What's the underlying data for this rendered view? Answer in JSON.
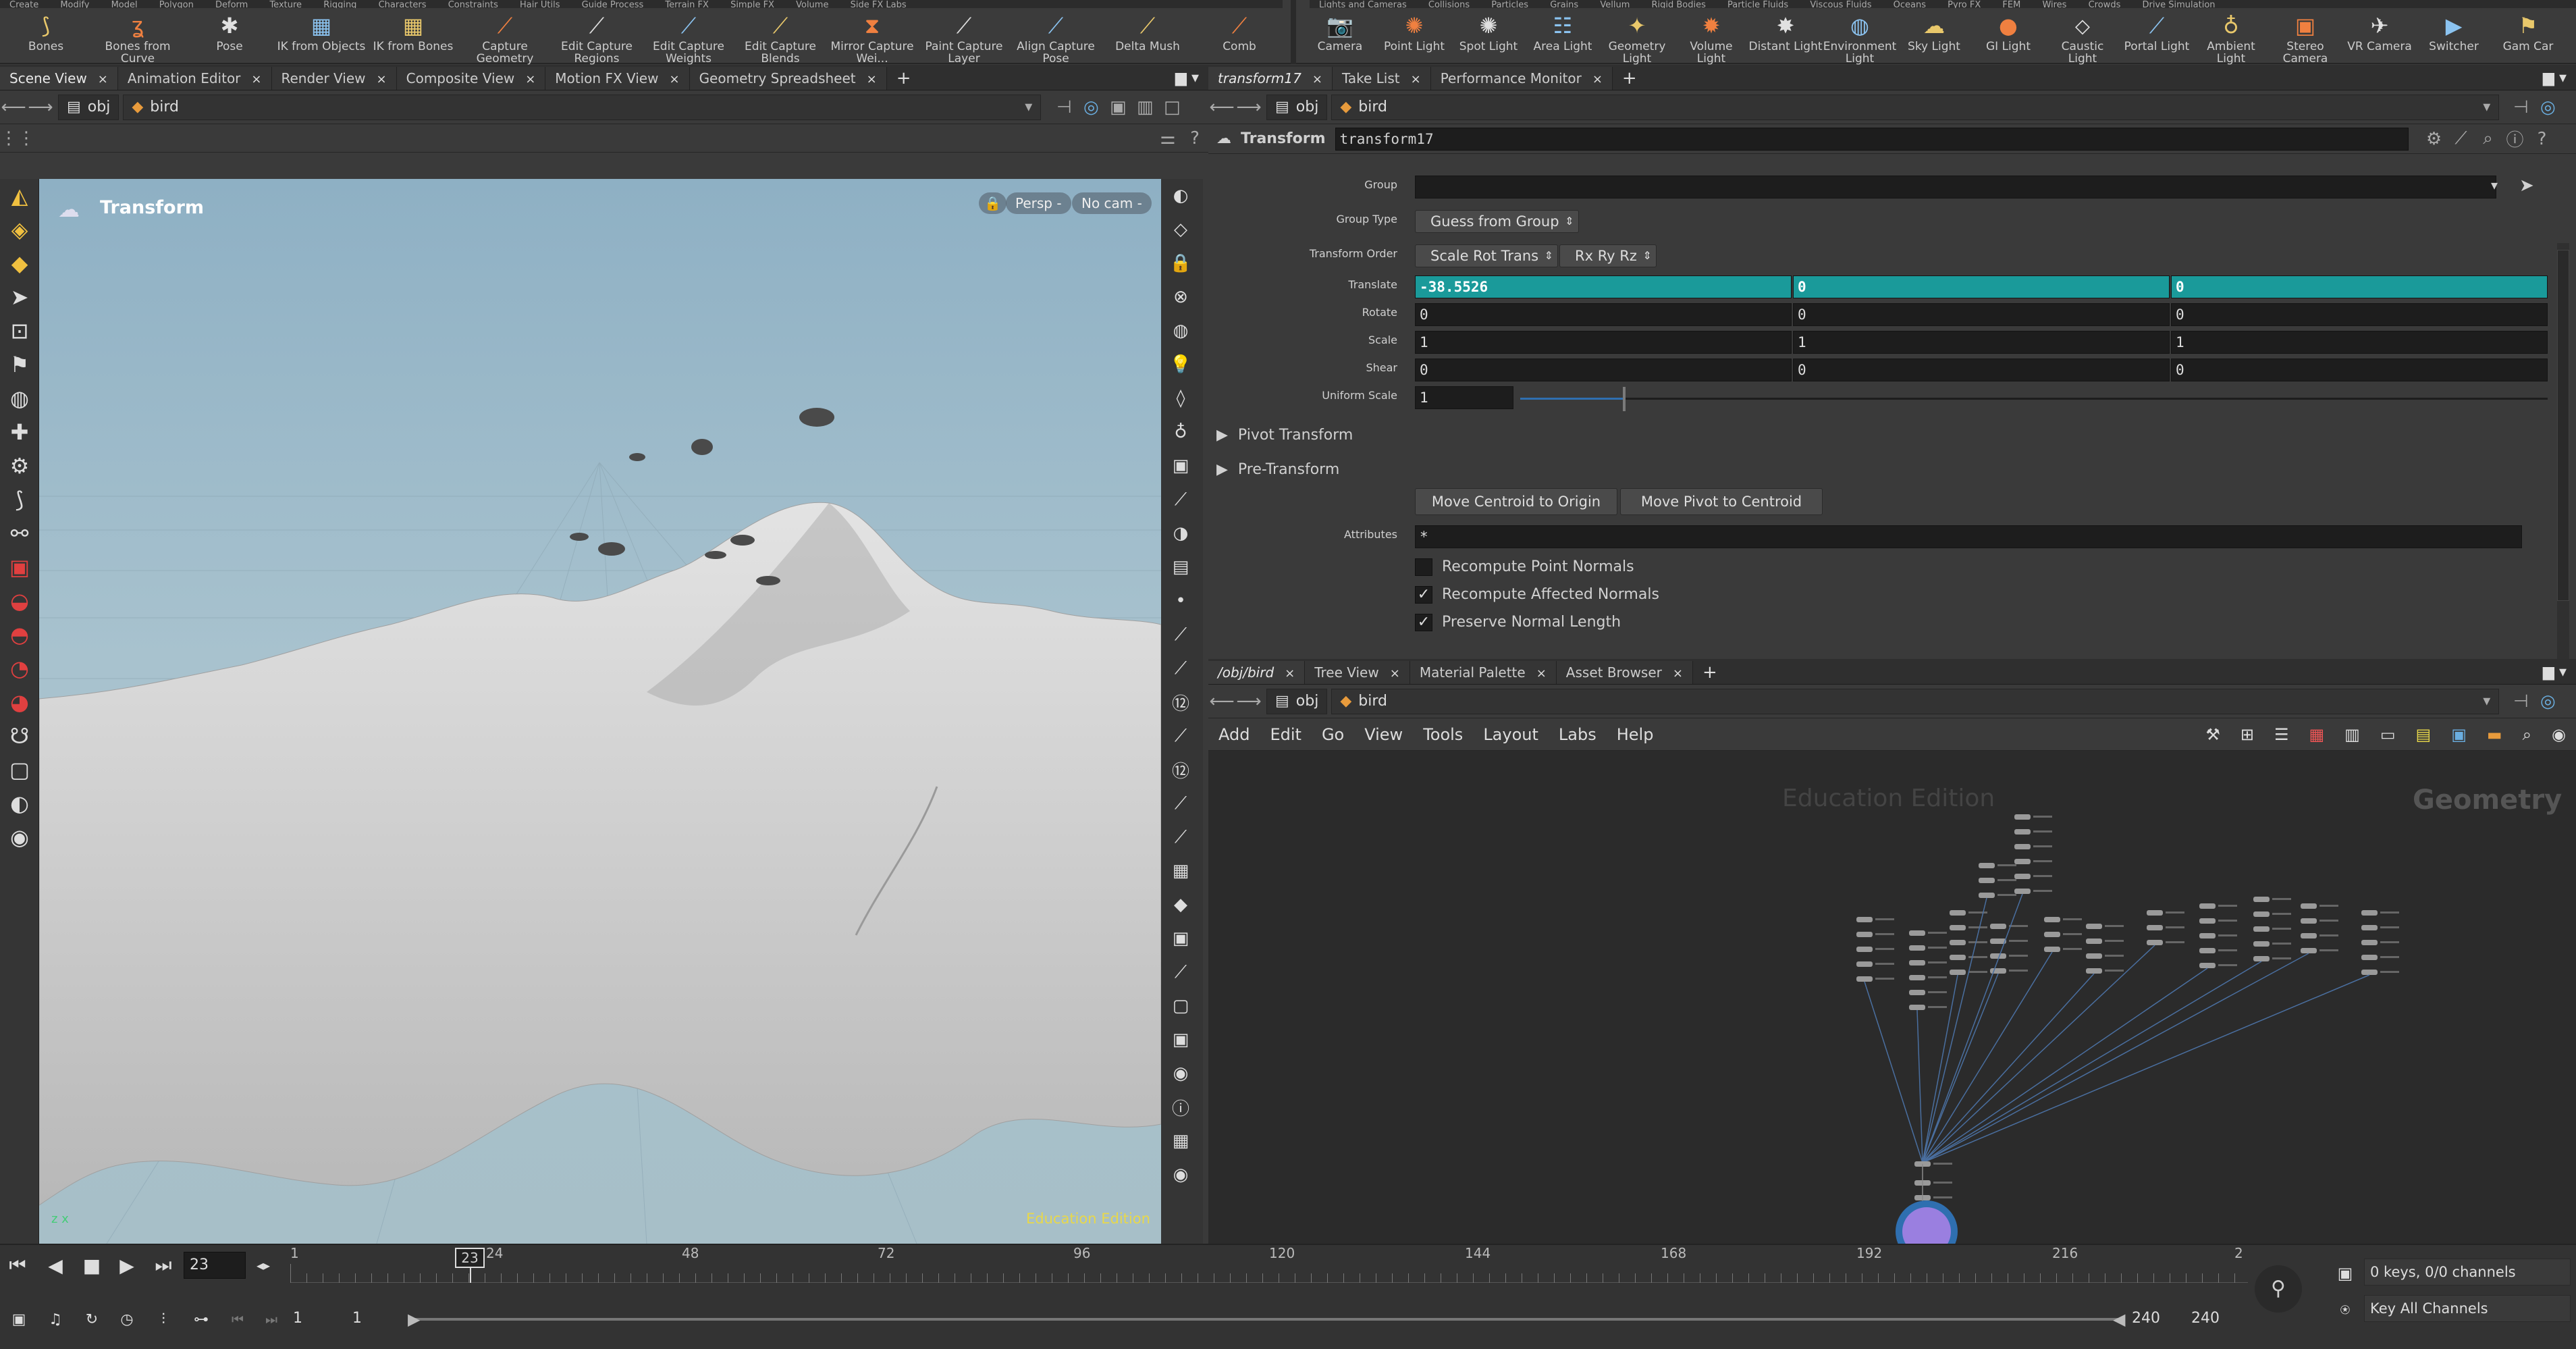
{
  "shelf": {
    "tabs_left": [
      "Create",
      "Modify",
      "Model",
      "Polygon",
      "Deform",
      "Texture",
      "Rigging",
      "Characters",
      "Constraints",
      "Hair Utils",
      "Guide Process",
      "Terrain FX",
      "Simple FX",
      "Volume",
      "Side FX Labs"
    ],
    "tabs_right": [
      "Lights and Cameras",
      "Collisions",
      "Particles",
      "Grains",
      "Vellum",
      "Rigid Bodies",
      "Particle Fluids",
      "Viscous Fluids",
      "Oceans",
      "Pyro FX",
      "FEM",
      "Wires",
      "Crowds",
      "Drive Simulation"
    ],
    "tools_left": [
      {
        "label": "Bones",
        "icon": "bones-icon",
        "glyph": "⟆"
      },
      {
        "label": "Bones from Curve",
        "icon": "bones-curve-icon",
        "glyph": "ʓ"
      },
      {
        "label": "Pose",
        "icon": "pose-icon",
        "glyph": "✱"
      },
      {
        "label": "IK from Objects",
        "icon": "ik-objects-icon",
        "glyph": "▦"
      },
      {
        "label": "IK from Bones",
        "icon": "ik-bones-icon",
        "glyph": "▦"
      },
      {
        "label": "Capture Geometry",
        "icon": "capture-geometry-icon",
        "glyph": "⟋"
      },
      {
        "label": "Edit Capture Regions",
        "icon": "edit-capture-regions-icon",
        "glyph": "⟋"
      },
      {
        "label": "Edit Capture Weights",
        "icon": "edit-capture-weights-icon",
        "glyph": "⟋"
      },
      {
        "label": "Edit Capture Blends",
        "icon": "edit-capture-blends-icon",
        "glyph": "⟋"
      },
      {
        "label": "Mirror Capture Wei...",
        "icon": "mirror-capture-icon",
        "glyph": "⧗"
      },
      {
        "label": "Paint Capture Layer",
        "icon": "paint-capture-icon",
        "glyph": "⟋"
      },
      {
        "label": "Align Capture Pose",
        "icon": "align-capture-icon",
        "glyph": "⟋"
      },
      {
        "label": "Delta Mush",
        "icon": "delta-mush-icon",
        "glyph": "⟋"
      },
      {
        "label": "Comb",
        "icon": "comb-icon",
        "glyph": "⟋"
      }
    ],
    "tools_right": [
      {
        "label": "Camera",
        "icon": "camera-icon",
        "glyph": "📷"
      },
      {
        "label": "Point Light",
        "icon": "point-light-icon",
        "glyph": "✺"
      },
      {
        "label": "Spot Light",
        "icon": "spot-light-icon",
        "glyph": "✺"
      },
      {
        "label": "Area Light",
        "icon": "area-light-icon",
        "glyph": "☷"
      },
      {
        "label": "Geometry Light",
        "icon": "geometry-light-icon",
        "glyph": "✦"
      },
      {
        "label": "Volume Light",
        "icon": "volume-light-icon",
        "glyph": "✹"
      },
      {
        "label": "Distant Light",
        "icon": "distant-light-icon",
        "glyph": "✸"
      },
      {
        "label": "Environment Light",
        "icon": "environment-light-icon",
        "glyph": "◍"
      },
      {
        "label": "Sky Light",
        "icon": "sky-light-icon",
        "glyph": "☁"
      },
      {
        "label": "GI Light",
        "icon": "gi-light-icon",
        "glyph": "●"
      },
      {
        "label": "Caustic Light",
        "icon": "caustic-light-icon",
        "glyph": "⬦"
      },
      {
        "label": "Portal Light",
        "icon": "portal-light-icon",
        "glyph": "⟋"
      },
      {
        "label": "Ambient Light",
        "icon": "ambient-light-icon",
        "glyph": "♁"
      },
      {
        "label": "Stereo Camera",
        "icon": "stereo-camera-icon",
        "glyph": "▣"
      },
      {
        "label": "VR Camera",
        "icon": "vr-camera-icon",
        "glyph": "✈"
      },
      {
        "label": "Switcher",
        "icon": "switcher-icon",
        "glyph": "▶"
      },
      {
        "label": "Gam Car",
        "icon": "gamepad-camera-icon",
        "glyph": "⚑"
      }
    ]
  },
  "scene_pane": {
    "tabs": [
      {
        "label": "Scene View"
      },
      {
        "label": "Animation Editor"
      },
      {
        "label": "Render View"
      },
      {
        "label": "Composite View"
      },
      {
        "label": "Motion FX View"
      },
      {
        "label": "Geometry Spreadsheet"
      }
    ],
    "path": {
      "root": "obj",
      "node": "bird"
    },
    "viewport": {
      "title": "Transform",
      "persp_label": "Persp -",
      "cam_label": "No cam -",
      "watermark": "Education Edition",
      "axis_label": "z x"
    }
  },
  "param_pane": {
    "tabs": [
      {
        "label": "transform17"
      },
      {
        "label": "Take List"
      },
      {
        "label": "Performance Monitor"
      }
    ],
    "path": {
      "root": "obj",
      "node": "bird"
    },
    "node_type": "Transform",
    "node_name": "transform17",
    "params": {
      "group_label": "Group",
      "group_value": "",
      "group_type_label": "Group Type",
      "group_type_value": "Guess from Group",
      "transform_order_label": "Transform Order",
      "transform_order_value": "Scale Rot Trans",
      "rot_order_value": "Rx Ry Rz",
      "translate_label": "Translate",
      "translate": [
        "-38.5526",
        "0",
        "0"
      ],
      "rotate_label": "Rotate",
      "rotate": [
        "0",
        "0",
        "0"
      ],
      "scale_label": "Scale",
      "scale": [
        "1",
        "1",
        "1"
      ],
      "shear_label": "Shear",
      "shear": [
        "0",
        "0",
        "0"
      ],
      "uniform_scale_label": "Uniform Scale",
      "uniform_scale": "1",
      "uniform_scale_fraction": 0.1,
      "pivot_transform_label": "Pivot Transform",
      "pre_transform_label": "Pre-Transform",
      "move_centroid_label": "Move Centroid to Origin",
      "move_pivot_label": "Move Pivot to Centroid",
      "attributes_label": "Attributes",
      "attributes_value": "*",
      "recompute_point_normals_label": "Recompute Point Normals",
      "recompute_point_normals": "",
      "recompute_affected_normals_label": "Recompute Affected Normals",
      "recompute_affected_normals": "✓",
      "preserve_normal_length_label": "Preserve Normal Length",
      "preserve_normal_length": "✓"
    }
  },
  "network_pane": {
    "tabs": [
      {
        "label": "/obj/bird"
      },
      {
        "label": "Tree View"
      },
      {
        "label": "Material Palette"
      },
      {
        "label": "Asset Browser"
      }
    ],
    "path": {
      "root": "obj",
      "node": "bird"
    },
    "menu": [
      "Add",
      "Edit",
      "Go",
      "View",
      "Tools",
      "Layout",
      "Labs",
      "Help"
    ],
    "watermark": "Education Edition",
    "context_label": "Geometry"
  },
  "timeline": {
    "current_frame": "23",
    "frame_marker": "23",
    "ticks": [
      "1",
      "24",
      "48",
      "72",
      "96",
      "120",
      "144",
      "168",
      "192",
      "216",
      "2"
    ],
    "range_start": "1",
    "range_start2": "1",
    "range_end": "240",
    "range_end2": "240",
    "keys_label": "0 keys, 0/0 channels",
    "key_all_label": "Key All Channels"
  },
  "colors": {
    "accent": "#1a9a9a",
    "viewport_sky": "#9bb8c7",
    "terrain": "#cfcfcf",
    "node_highlight": "#8e7fd6"
  }
}
